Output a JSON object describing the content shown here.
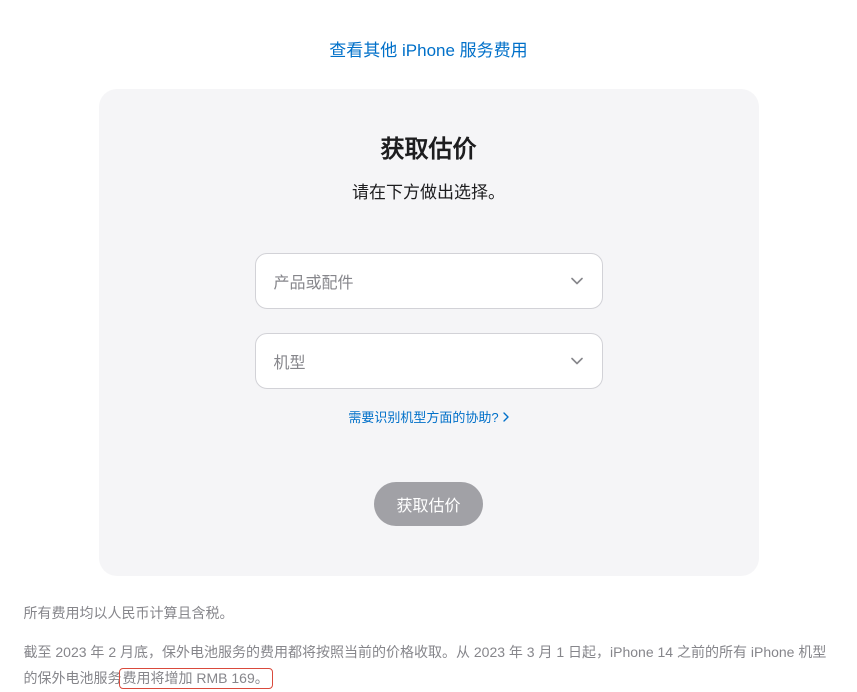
{
  "topLink": "查看其他 iPhone 服务费用",
  "card": {
    "title": "获取估价",
    "subtitle": "请在下方做出选择。",
    "select1": {
      "placeholder": "产品或配件"
    },
    "select2": {
      "placeholder": "机型"
    },
    "helpLink": "需要识别机型方面的协助?",
    "submit": "获取估价"
  },
  "footer": {
    "line1": "所有费用均以人民币计算且含税。",
    "line2_pre": "截至 2023 年 2 月底，保外电池服务的费用都将按照当前的价格收取。从 2023 年 3 月 1 日起，iPhone 14 之前的所有 iPhone 机型的保外电池服务",
    "line2_highlight": "费用将增加 RMB 169。"
  }
}
